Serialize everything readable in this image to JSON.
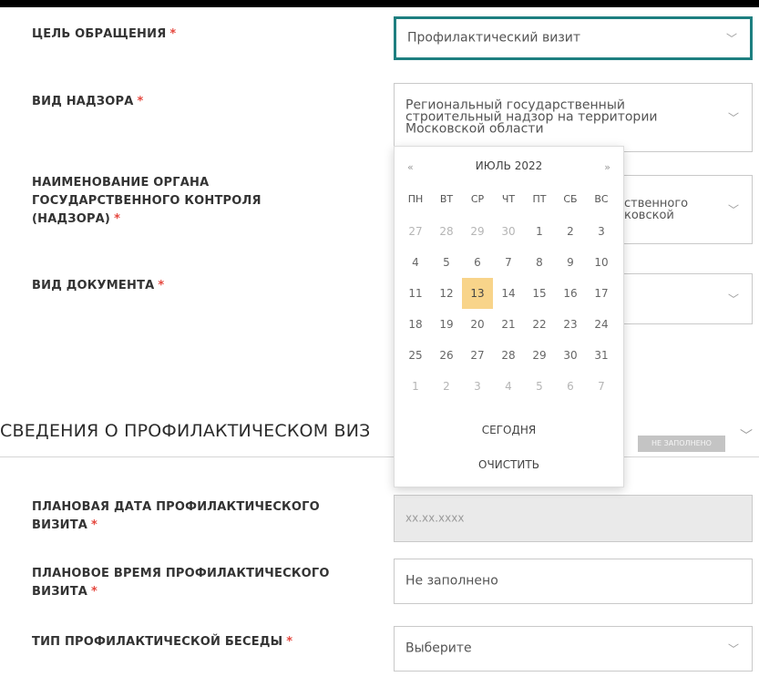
{
  "form": {
    "purpose": {
      "label": "ЦЕЛЬ ОБРАЩЕНИЯ",
      "value": "Профилактический визит"
    },
    "supervision": {
      "label": "ВИД НАДЗОРА",
      "value": "Региональный государственный строительный надзор на территории Московской области"
    },
    "authority": {
      "label": "НАИМЕНОВАНИЕ ОРГАНА ГОСУДАРСТВЕННОГО КОНТРОЛЯ (НАДЗОРА)",
      "value_fragment": "ственного ковской"
    },
    "doc_type": {
      "label": "ВИД ДОКУМЕНТА"
    },
    "required_mark": "*"
  },
  "section": {
    "title": "СВЕДЕНИЯ О ПРОФИЛАКТИЧЕСКОМ ВИЗ",
    "badge": "НЕ ЗАПОЛНЕНО"
  },
  "visit": {
    "date": {
      "label": "ПЛАНОВАЯ ДАТА ПРОФИЛАКТИЧЕСКОГО ВИЗИТА",
      "placeholder": "xx.xx.xxxx"
    },
    "time": {
      "label": "ПЛАНОВОЕ ВРЕМЯ ПРОФИЛАКТИЧЕСКОГО ВИЗИТА",
      "value": "Не заполнено"
    },
    "talk": {
      "label": "ТИП ПРОФИЛАКТИЧЕСКОЙ БЕСЕДЫ",
      "value": "Выберите"
    }
  },
  "calendar": {
    "prev": "«",
    "next": "»",
    "month": "ИЮЛЬ 2022",
    "weekdays": [
      "ПН",
      "ВТ",
      "СР",
      "ЧТ",
      "ПТ",
      "СБ",
      "ВС"
    ],
    "weeks": [
      [
        {
          "d": "27",
          "m": true
        },
        {
          "d": "28",
          "m": true
        },
        {
          "d": "29",
          "m": true
        },
        {
          "d": "30",
          "m": true
        },
        {
          "d": "1"
        },
        {
          "d": "2"
        },
        {
          "d": "3"
        }
      ],
      [
        {
          "d": "4"
        },
        {
          "d": "5"
        },
        {
          "d": "6"
        },
        {
          "d": "7"
        },
        {
          "d": "8"
        },
        {
          "d": "9"
        },
        {
          "d": "10"
        }
      ],
      [
        {
          "d": "11"
        },
        {
          "d": "12"
        },
        {
          "d": "13",
          "today": true
        },
        {
          "d": "14"
        },
        {
          "d": "15"
        },
        {
          "d": "16"
        },
        {
          "d": "17"
        }
      ],
      [
        {
          "d": "18"
        },
        {
          "d": "19"
        },
        {
          "d": "20"
        },
        {
          "d": "21"
        },
        {
          "d": "22"
        },
        {
          "d": "23"
        },
        {
          "d": "24"
        }
      ],
      [
        {
          "d": "25"
        },
        {
          "d": "26"
        },
        {
          "d": "27"
        },
        {
          "d": "28"
        },
        {
          "d": "29"
        },
        {
          "d": "30"
        },
        {
          "d": "31"
        }
      ],
      [
        {
          "d": "1",
          "m": true
        },
        {
          "d": "2",
          "m": true
        },
        {
          "d": "3",
          "m": true
        },
        {
          "d": "4",
          "m": true
        },
        {
          "d": "5",
          "m": true
        },
        {
          "d": "6",
          "m": true
        },
        {
          "d": "7",
          "m": true
        }
      ]
    ],
    "today_button": "СЕГОДНЯ",
    "clear_button": "ОЧИСТИТЬ"
  },
  "icons": {
    "dropdown": "chevron-down-icon"
  },
  "colors": {
    "focus_border": "#1e7f80",
    "required": "#e5473e",
    "today_highlight": "#f8d48a"
  }
}
